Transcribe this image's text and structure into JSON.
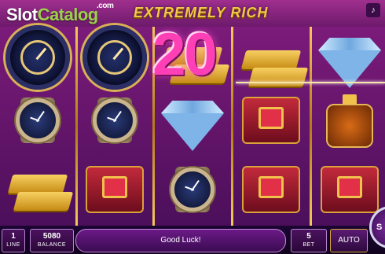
{
  "watermark": {
    "slot": "Slot",
    "catalog": "Catalog",
    "com": ".com"
  },
  "game_title": "EXTREMELY RICH",
  "sound_icon": "speaker-icon",
  "win": {
    "amount": "20"
  },
  "reels": [
    [
      "clock",
      "watch",
      "gold"
    ],
    [
      "clock",
      "watch",
      "ring"
    ],
    [
      "gold",
      "diamond",
      "watch"
    ],
    [
      "gold",
      "ring",
      "ring"
    ],
    [
      "diamond",
      "bottle",
      "ring"
    ]
  ],
  "bottom": {
    "lines_value": "1",
    "lines_label": "LINE",
    "balance_value": "5080",
    "balance_label": "BALANCE",
    "message": "Good Luck!",
    "bet_value": "5",
    "bet_label": "BET",
    "auto_label": "AUTO",
    "spin_label": "S"
  },
  "colors": {
    "accent_gold": "#f3c74c",
    "win_pink": "#ff3fb6",
    "background_purple": "#4a0f55"
  }
}
